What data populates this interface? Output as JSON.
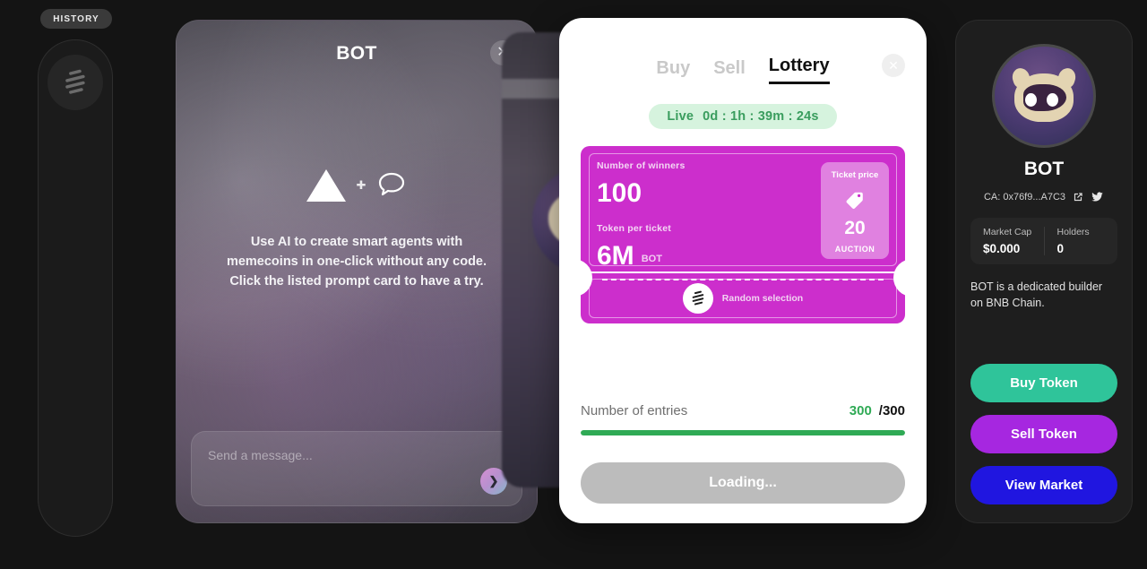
{
  "history": {
    "pill_label": "HISTORY",
    "logo_icon": "stripes-logo-icon"
  },
  "chat": {
    "title": "BOT",
    "close_icon": "close-icon",
    "empty_state": {
      "triangle_icon": "triangle-icon",
      "plus_icon": "plus-icon",
      "bubble_icon": "chat-bubble-icon",
      "text": "Use AI to create smart agents with memecoins in one-click without any code. Click the listed prompt card to have a try."
    },
    "composer": {
      "placeholder": "Send a message...",
      "value": "",
      "send_icon": "send-chevron-icon"
    }
  },
  "modal": {
    "tabs": [
      {
        "label": "Buy",
        "active": false
      },
      {
        "label": "Sell",
        "active": false
      },
      {
        "label": "Lottery",
        "active": true
      }
    ],
    "close_icon": "close-icon",
    "status": {
      "state": "Live",
      "countdown": "0d : 1h : 39m : 24s",
      "bg_color": "#d6f3de",
      "text_color": "#3a9d5e"
    },
    "ticket": {
      "color": "#cc2ecc",
      "winners_label": "Number of winners",
      "winners_value": "100",
      "token_per_ticket_label": "Token per ticket",
      "token_per_ticket_value": "6M",
      "token_symbol": "BOT",
      "price_label": "Ticket price",
      "price_icon": "price-tag-icon",
      "price_value": "20",
      "price_mode": "AUCTION",
      "stub_logo_icon": "stripes-logo-icon",
      "stub_text": "Random selection"
    },
    "entries": {
      "label": "Number of entries",
      "current": "300",
      "separator": "/",
      "max": "300",
      "progress_percent": 100,
      "fill_color": "#2faa55"
    },
    "submit": {
      "label": "Loading...",
      "disabled": true
    }
  },
  "token_panel": {
    "avatar_icon": "bot-ghost-avatar",
    "name": "BOT",
    "contract": "CA: 0x76f9...A7C3",
    "external_link_icon": "external-link-icon",
    "twitter_icon": "twitter-icon",
    "stats": [
      {
        "label": "Market Cap",
        "value": "$0.000"
      },
      {
        "label": "Holders",
        "value": "0"
      }
    ],
    "description": "BOT is a dedicated builder on BNB Chain.",
    "actions": [
      {
        "label": "Buy Token",
        "color": "#2fc49a"
      },
      {
        "label": "Sell Token",
        "color": "#a627e0"
      },
      {
        "label": "View Market",
        "color": "#2016e0"
      }
    ]
  }
}
